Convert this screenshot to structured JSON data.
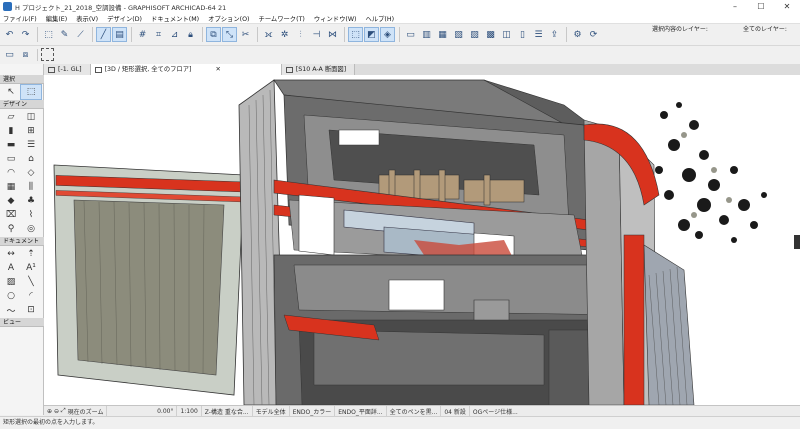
{
  "window": {
    "title": "H プロジェクト_21_2018_空調設備 - GRAPHISOFT ARCHICAD-64 21",
    "controls": [
      "minimize-icon",
      "maximize-icon",
      "close-icon"
    ]
  },
  "menu": [
    "ファイル(F)",
    "編集(E)",
    "表示(V)",
    "デザイン(D)",
    "ドキュメント(M)",
    "オプション(O)",
    "チームワーク(T)",
    "ウィンドウ(W)",
    "ヘルプ(H)"
  ],
  "toolbar": {
    "layer_label_1": "選択内容のレイヤー:",
    "layer_label_2": "全てのレイヤー:"
  },
  "tabs": [
    {
      "label": "[-1. GL]",
      "active": false
    },
    {
      "label": "[3D / 矩形選択, 全てのフロア]",
      "active": true
    },
    {
      "label": "[S10 A-A 断面図]",
      "active": false
    }
  ],
  "palette": {
    "section_select": "選択",
    "section_design": "デザイン",
    "section_document": "ドキュメント",
    "section_view": "ビュー"
  },
  "navbar": {
    "zoom_label": "現在のズーム",
    "angle": "0.00°",
    "scale": "1:100",
    "structure": "Z-構造 重な合...",
    "model": "モデル全体",
    "pen": "ENDO_カラー",
    "graphic": "ENDO_平面詳...",
    "override": "全てのペンを黒...",
    "renovation": "04 新設",
    "option": "OGページ仕様..."
  },
  "status": "矩形選択の最初の点を入力します。",
  "colors": {
    "accent_red": "#d8331e",
    "selection_blue": "#cfe3f8",
    "steel_gray": "#8a8a8a"
  }
}
